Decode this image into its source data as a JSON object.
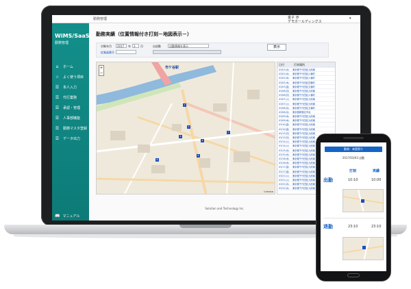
{
  "app": {
    "logo": "WiMS/SaaS",
    "logo_sub": "勤務管理",
    "system_name": "勤務管理",
    "user_name": "金子 歩",
    "company": "デモホールディングス"
  },
  "sidebar": {
    "items": [
      {
        "label": "ホーム",
        "icon": "home-icon"
      },
      {
        "label": "よく使う項目",
        "icon": "star-icon"
      },
      {
        "label": "本人入力",
        "icon": "list-icon"
      },
      {
        "label": "代行業務",
        "icon": "list-icon"
      },
      {
        "label": "承認・管理",
        "icon": "list-icon"
      },
      {
        "label": "人事部機能",
        "icon": "list-icon"
      },
      {
        "label": "勤務マスタ登録",
        "icon": "list-icon"
      },
      {
        "label": "データ出力",
        "icon": "list-icon"
      }
    ],
    "manual": "マニュアル"
  },
  "page": {
    "title": "勤務実績（位置情報付き打刻－地図表示－）",
    "form": {
      "target_label": "対象年月",
      "year_value": "2017",
      "year_unit": "年",
      "month_value": "3",
      "month_unit": "月",
      "kind_label": "出退勤",
      "kind_value": "出勤情報を表示",
      "staff_label": "従業員番号"
    },
    "display_button": "表示",
    "map": {
      "station": "市ケ谷駅",
      "credit": "©ZENRIN"
    },
    "table": {
      "headers": [
        "日付",
        "打刻場所"
      ],
      "rows": [
        [
          "03/01(水)",
          "東京都千代田区九段南"
        ],
        [
          "03/01(水)",
          "東京都千代田区六番町"
        ],
        [
          "03/02(木)",
          "東京都千代田区六番町"
        ],
        [
          "03/02(木)",
          "東京都千代田区四番町"
        ],
        [
          "03/03(金)",
          "東京都千代田区五番町"
        ],
        [
          "03/06(月)",
          "東京都千代田区九段南"
        ],
        [
          "03/06(月)",
          "東京都千代田区六番町"
        ],
        [
          "03/07(火)",
          "東京都千代田区九段南"
        ],
        [
          "03/07(火)",
          "東京都千代田区九段南"
        ],
        [
          "03/08(水)",
          "東京都千代田区五番町"
        ],
        [
          "03/08(水)",
          "東京都新宿区市谷"
        ],
        [
          "03/09(木)",
          "東京都千代田区九段南"
        ],
        [
          "03/09(木)",
          "東京都千代田区九段南"
        ],
        [
          "03/10(金)",
          "東京都千代田区九段南"
        ],
        [
          "03/10(金)",
          "東京都千代田区九段南"
        ],
        [
          "03/13(月)",
          "東京都千代田区九段南"
        ],
        [
          "03/13(月)",
          "東京都千代田区九段南"
        ],
        [
          "03/14(火)",
          "東京都千代田区九段南"
        ],
        [
          "03/14(火)",
          "東京都千代田区九段南"
        ],
        [
          "03/15(水)",
          "東京都千代田区九段南"
        ],
        [
          "03/15(水)",
          "東京都千代田区九段南"
        ],
        [
          "03/16(木)",
          "東京都千代田区九段南"
        ],
        [
          "03/16(木)",
          "東京都千代田区九段南"
        ],
        [
          "03/17(金)",
          "東京都千代田区九段南"
        ],
        [
          "03/17(金)",
          "東京都千代田区九段南"
        ],
        [
          "03/21(火)",
          "東京都千代田区九段南"
        ],
        [
          "03/21(火)",
          "東京都千代田区九段南"
        ],
        [
          "03/22(水)",
          "東京都千代田区九段南"
        ],
        [
          "03/22(水)",
          "東京都千代田区九段南"
        ]
      ]
    },
    "footer": "Solution and Technology Inc."
  },
  "phone": {
    "header": "勤務：来歴照り",
    "date": "2017/03/03",
    "date_suffix": "出勤",
    "col_stamp": "打刻",
    "col_actual": "実績",
    "in_label": "出勤",
    "in_stamp": "10:10",
    "in_actual": "10:00",
    "out_label": "退勤",
    "out_stamp": "23:10",
    "out_actual": "23:10"
  },
  "colors": {
    "sidebar": "#138f8a",
    "accent": "#1664c4",
    "link": "#1e56b5"
  }
}
